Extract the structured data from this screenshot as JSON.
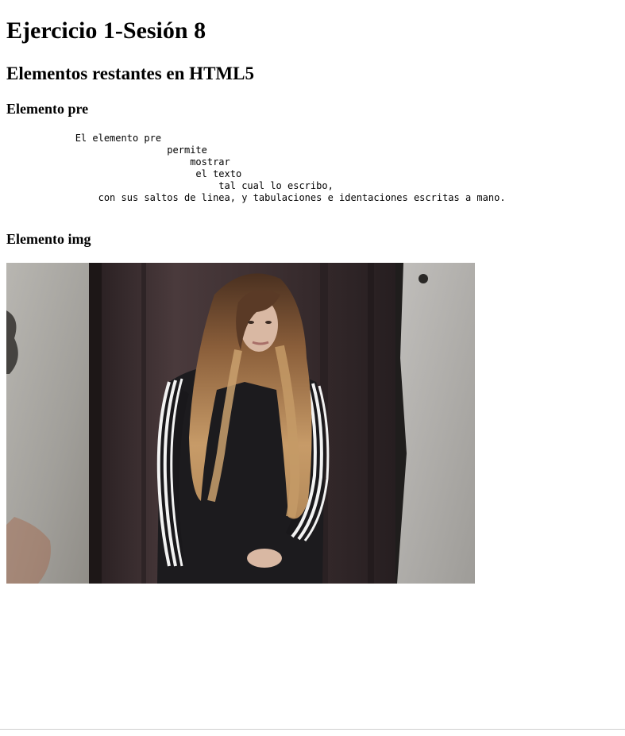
{
  "heading_main": "Ejercicio 1-Sesión 8",
  "heading_section": "Elementos restantes en HTML5",
  "pre_section": {
    "heading": "Elemento pre",
    "text": "            El elemento pre\n                            permite\n                                mostrar\n                                 el texto\n                                     tal cual lo escribo,\n                con sus saltos de linea, y tabulaciones e identaciones escritas a mano."
  },
  "img_section": {
    "heading": "Elemento img"
  },
  "photo_colors": {
    "wall_left": "#aaa8a3",
    "door": "#3a2d2f",
    "wall_right": "#b2b0ad",
    "jacket": "#1c1b1e",
    "hair": "#b58b5c",
    "skin": "#d9b8a3",
    "stripe": "#f2f2f2"
  }
}
